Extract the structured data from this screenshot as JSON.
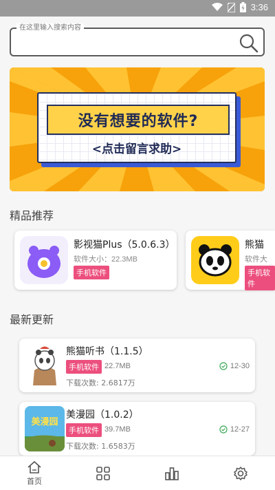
{
  "status_bar": {
    "time": "3:36"
  },
  "search": {
    "placeholder": "在这里输入搜索内容"
  },
  "banner": {
    "title": "没有想要的软件?",
    "subtitle": "<点击留言求助>"
  },
  "sections": {
    "recommended": "精品推荐",
    "latest": "最新更新"
  },
  "recommended": [
    {
      "name": "影视猫Plus（5.0.6.3）",
      "size": "软件大小：22.3MB",
      "tag": "手机软件"
    },
    {
      "name": "熊猫",
      "size": "软件大",
      "tag": "手机软件"
    }
  ],
  "updates": [
    {
      "name": "熊猫听书（1.1.5）",
      "tag": "手机软件",
      "size": "22.7MB",
      "downloads": "下载次数: 2.6817万",
      "date": "12-30"
    },
    {
      "name": "美漫园（1.0.2）",
      "tag": "手机软件",
      "size": "39.7MB",
      "downloads": "下载次数: 1.6583万",
      "date": "12-27",
      "icon_text": "美漫园"
    }
  ],
  "tabbar": {
    "home": "首页"
  },
  "colors": {
    "accent": "#ec4f7d",
    "banner": "#f7a20a"
  }
}
